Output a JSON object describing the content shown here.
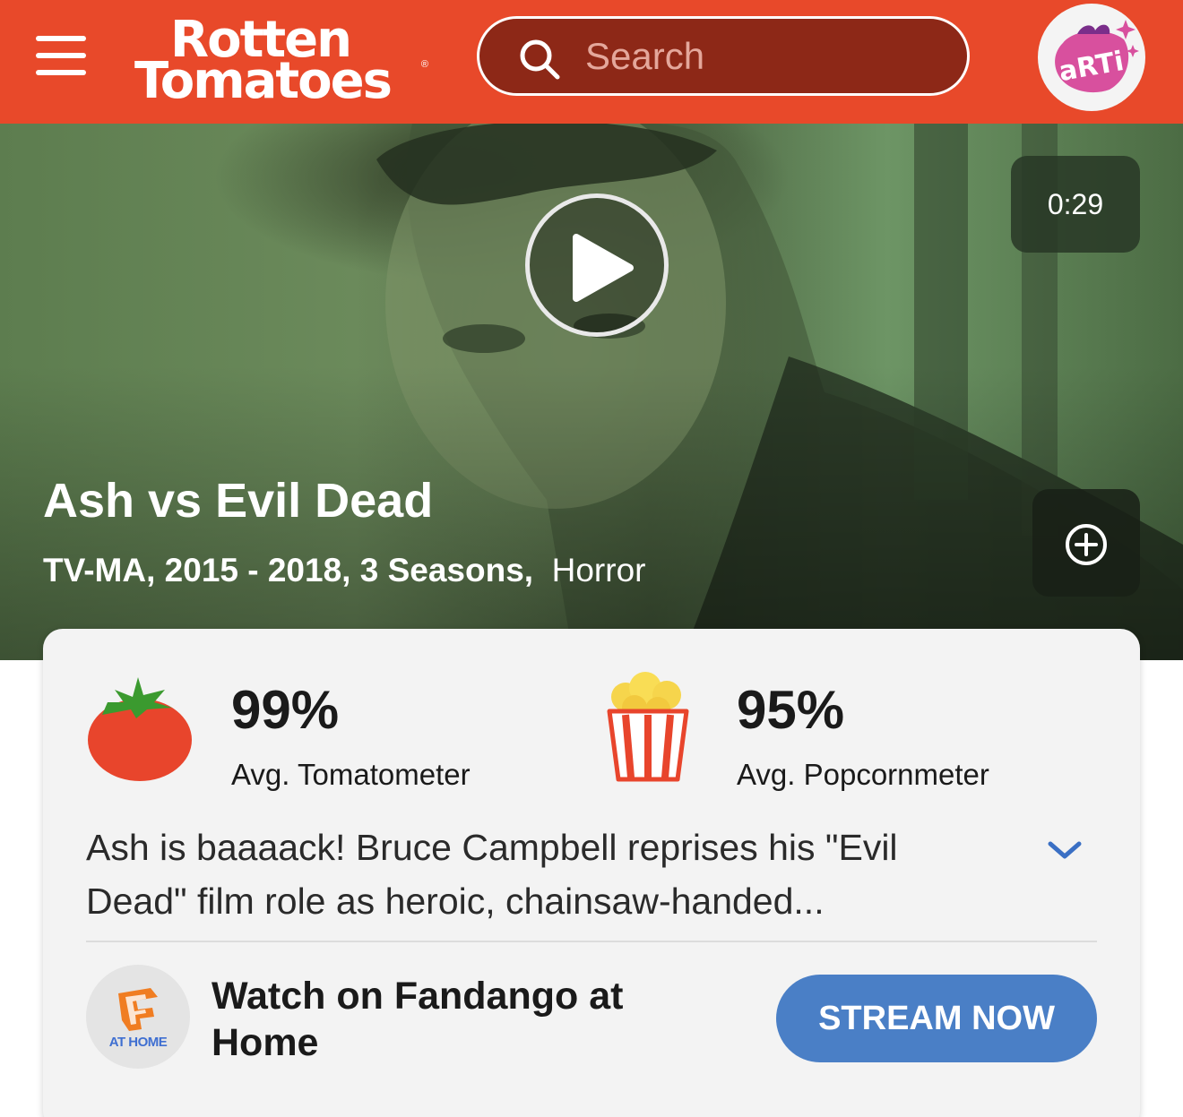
{
  "header": {
    "logo_line1": "Rotten",
    "logo_line2": "Tomatoes",
    "logo_reg": "®",
    "search_placeholder": "Search",
    "avatar_text": "aRTi"
  },
  "hero": {
    "duration": "0:29",
    "title": "Ash vs Evil Dead",
    "meta_bold": "TV-MA, 2015 - 2018, 3 Seasons,",
    "genre": "Horror"
  },
  "scores": {
    "tomatometer": {
      "value": "99%",
      "label": "Avg. Tomatometer"
    },
    "popcornmeter": {
      "value": "95%",
      "label": "Avg. Popcornmeter"
    }
  },
  "synopsis": "Ash is baaaack! Bruce Campbell reprises his \"Evil Dead\" film role as heroic, chainsaw-handed...",
  "watch": {
    "provider_badge": "AT HOME",
    "text": "Watch on Fandango at Home",
    "button": "STREAM NOW"
  },
  "colors": {
    "brand": "#e8492a",
    "search_bg": "#8d2817",
    "stream_button": "#4a7fc6",
    "tomato": "#e8452c"
  },
  "icons": [
    "menu-icon",
    "search-icon",
    "play-icon",
    "plus-circle-icon",
    "tomato-icon",
    "popcorn-icon",
    "chevron-down-icon",
    "fandango-icon"
  ]
}
